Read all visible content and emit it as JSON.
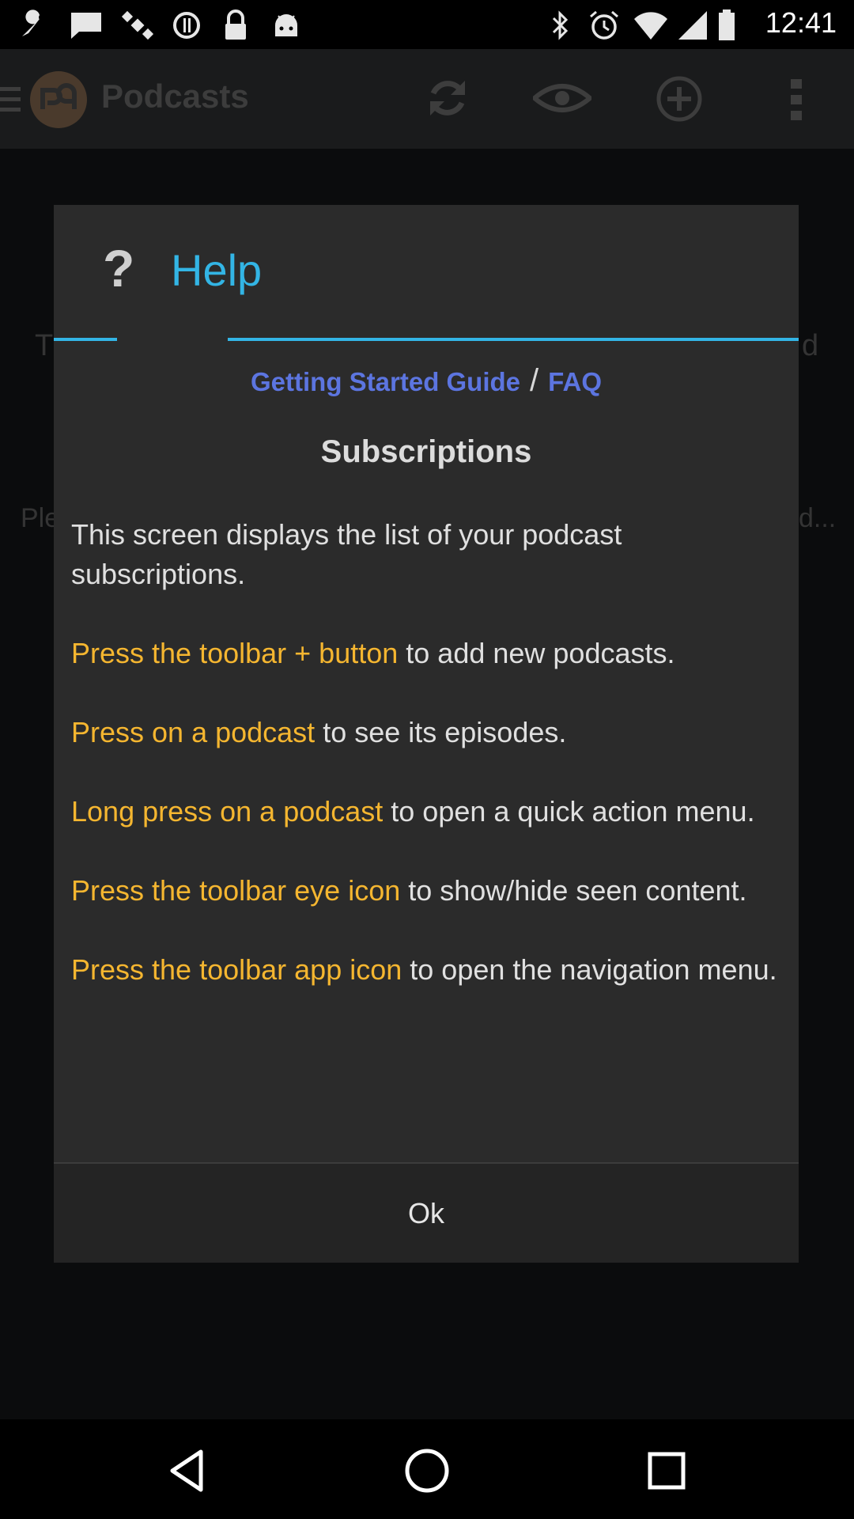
{
  "status_bar": {
    "time": "12:41",
    "icons": [
      "wrench-icon",
      "chat-icon",
      "satellite-icon",
      "sync-icon",
      "lock-icon",
      "android-icon",
      "bluetooth-icon",
      "alarm-icon",
      "wifi-icon",
      "signal-icon",
      "battery-icon"
    ]
  },
  "toolbar": {
    "title": "Podcasts",
    "icons": [
      "menu-icon",
      "app-logo-icon",
      "refresh-icon",
      "eye-icon",
      "add-icon",
      "overflow-menu-icon"
    ]
  },
  "background": {
    "fragment_left_1": "T",
    "fragment_right_1": "d",
    "fragment_left_2": "Ple",
    "fragment_right_2": "d..."
  },
  "dialog": {
    "title": "Help",
    "title_icon": "question-icon",
    "link_guide": "Getting Started Guide",
    "separator": "/",
    "link_faq": "FAQ",
    "section_title": "Subscriptions",
    "paragraphs": [
      {
        "highlight": "",
        "text": "This screen displays the list of your podcast subscriptions."
      },
      {
        "highlight": "Press the toolbar + button",
        "text": " to add new podcasts."
      },
      {
        "highlight": "Press on a podcast",
        "text": " to see its episodes."
      },
      {
        "highlight": "Long press on a podcast",
        "text": " to open a quick action menu."
      },
      {
        "highlight": "Press the toolbar eye icon",
        "text": " to show/hide seen content."
      },
      {
        "highlight": "Press the toolbar app icon",
        "text": " to open the navigation menu."
      }
    ],
    "ok_label": "Ok"
  },
  "nav_bar": {
    "icons": [
      "back-icon",
      "home-icon",
      "recents-icon"
    ]
  },
  "colors": {
    "accent": "#33b5e5",
    "link": "#5c75e0",
    "highlight": "#f5b630",
    "dialog_bg": "#2b2b2b"
  }
}
